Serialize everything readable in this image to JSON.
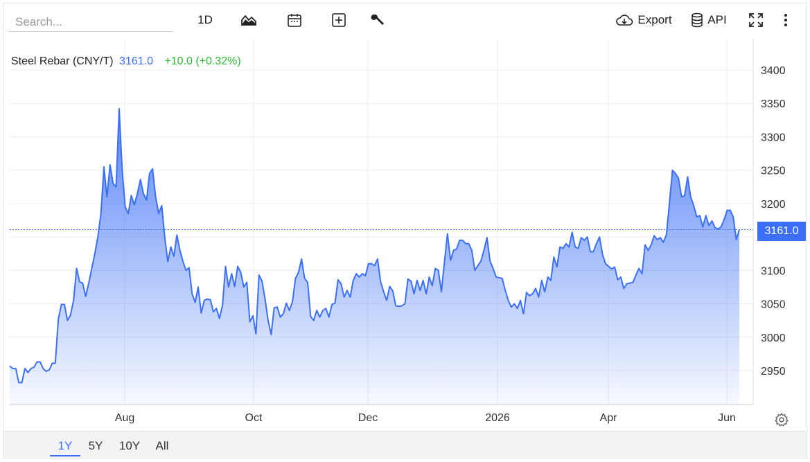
{
  "toolbar": {
    "search_placeholder": "Search...",
    "interval_label": "1D",
    "export_label": "Export",
    "api_label": "API",
    "icons": [
      "area-chart-icon",
      "calendar-icon",
      "plus-square-icon",
      "wrench-icon",
      "cloud-download-icon",
      "database-icon",
      "fullscreen-icon",
      "more-vertical-icon"
    ]
  },
  "legend": {
    "name": "Steel Rebar (CNY/T)",
    "value": "3161.0",
    "change": "+10.0 (+0.32%)"
  },
  "price_tag": "3161.0",
  "range_buttons": [
    "1Y",
    "5Y",
    "10Y",
    "All"
  ],
  "active_range": "1Y",
  "colors": {
    "line": "#3b6ff5",
    "positive": "#32b835"
  },
  "chart_data": {
    "type": "area",
    "title": "Steel Rebar (CNY/T)",
    "x_ticks": [
      "Aug",
      "Oct",
      "Dec",
      "2026",
      "Apr",
      "Jun"
    ],
    "y_ticks": [
      2950,
      3000,
      3050,
      3100,
      3150,
      3200,
      3250,
      3300,
      3350,
      3400
    ],
    "ylim": [
      2905,
      3415
    ],
    "last_value": 3161.0,
    "grid": true,
    "series": [
      {
        "values": [
          2957,
          2953,
          2953,
          2932,
          2932,
          2953,
          2947,
          2953,
          2955,
          2963,
          2963,
          2953,
          2949,
          2951,
          2961,
          2961,
          3027,
          3049,
          3049,
          3025,
          3033,
          3055,
          3103,
          3083,
          3081,
          3061,
          3081,
          3103,
          3125,
          3150,
          3185,
          3255,
          3210,
          3258,
          3230,
          3225,
          3342,
          3250,
          3195,
          3185,
          3212,
          3198,
          3215,
          3236,
          3215,
          3205,
          3245,
          3252,
          3210,
          3185,
          3197,
          3150,
          3113,
          3135,
          3121,
          3153,
          3130,
          3113,
          3100,
          3104,
          3065,
          3052,
          3075,
          3036,
          3055,
          3057,
          3056,
          3038,
          3043,
          3028,
          3048,
          3106,
          3075,
          3095,
          3076,
          3106,
          3097,
          3075,
          3082,
          3023,
          3032,
          3005,
          3093,
          3084,
          3057,
          3025,
          3004,
          3044,
          3045,
          3030,
          3035,
          3051,
          3040,
          3053,
          3088,
          3097,
          3117,
          3088,
          3082,
          3031,
          3025,
          3040,
          3030,
          3040,
          3043,
          3030,
          3049,
          3051,
          3086,
          3080,
          3060,
          3070,
          3060,
          3085,
          3095,
          3090,
          3095,
          3092,
          3110,
          3110,
          3107,
          3117,
          3083,
          3068,
          3055,
          3076,
          3069,
          3047,
          3046,
          3047,
          3050,
          3087,
          3084,
          3065,
          3085,
          3070,
          3085,
          3065,
          3090,
          3077,
          3103,
          3100,
          3068,
          3112,
          3155,
          3115,
          3130,
          3132,
          3145,
          3145,
          3140,
          3140,
          3130,
          3100,
          3107,
          3114,
          3130,
          3149,
          3114,
          3103,
          3090,
          3089,
          3088,
          3070,
          3055,
          3045,
          3050,
          3043,
          3055,
          3035,
          3067,
          3062,
          3065,
          3073,
          3060,
          3085,
          3068,
          3090,
          3085,
          3120,
          3105,
          3135,
          3133,
          3140,
          3135,
          3157,
          3135,
          3133,
          3149,
          3145,
          3150,
          3128,
          3128,
          3140,
          3150,
          3124,
          3110,
          3106,
          3102,
          3105,
          3086,
          3090,
          3073,
          3080,
          3081,
          3082,
          3093,
          3103,
          3095,
          3138,
          3130,
          3138,
          3152,
          3146,
          3149,
          3142,
          3153,
          3200,
          3250,
          3245,
          3238,
          3210,
          3212,
          3240,
          3210,
          3197,
          3180,
          3182,
          3165,
          3182,
          3167,
          3174,
          3164,
          3162,
          3165,
          3176,
          3190,
          3190,
          3180,
          3146,
          3161
        ]
      }
    ]
  }
}
